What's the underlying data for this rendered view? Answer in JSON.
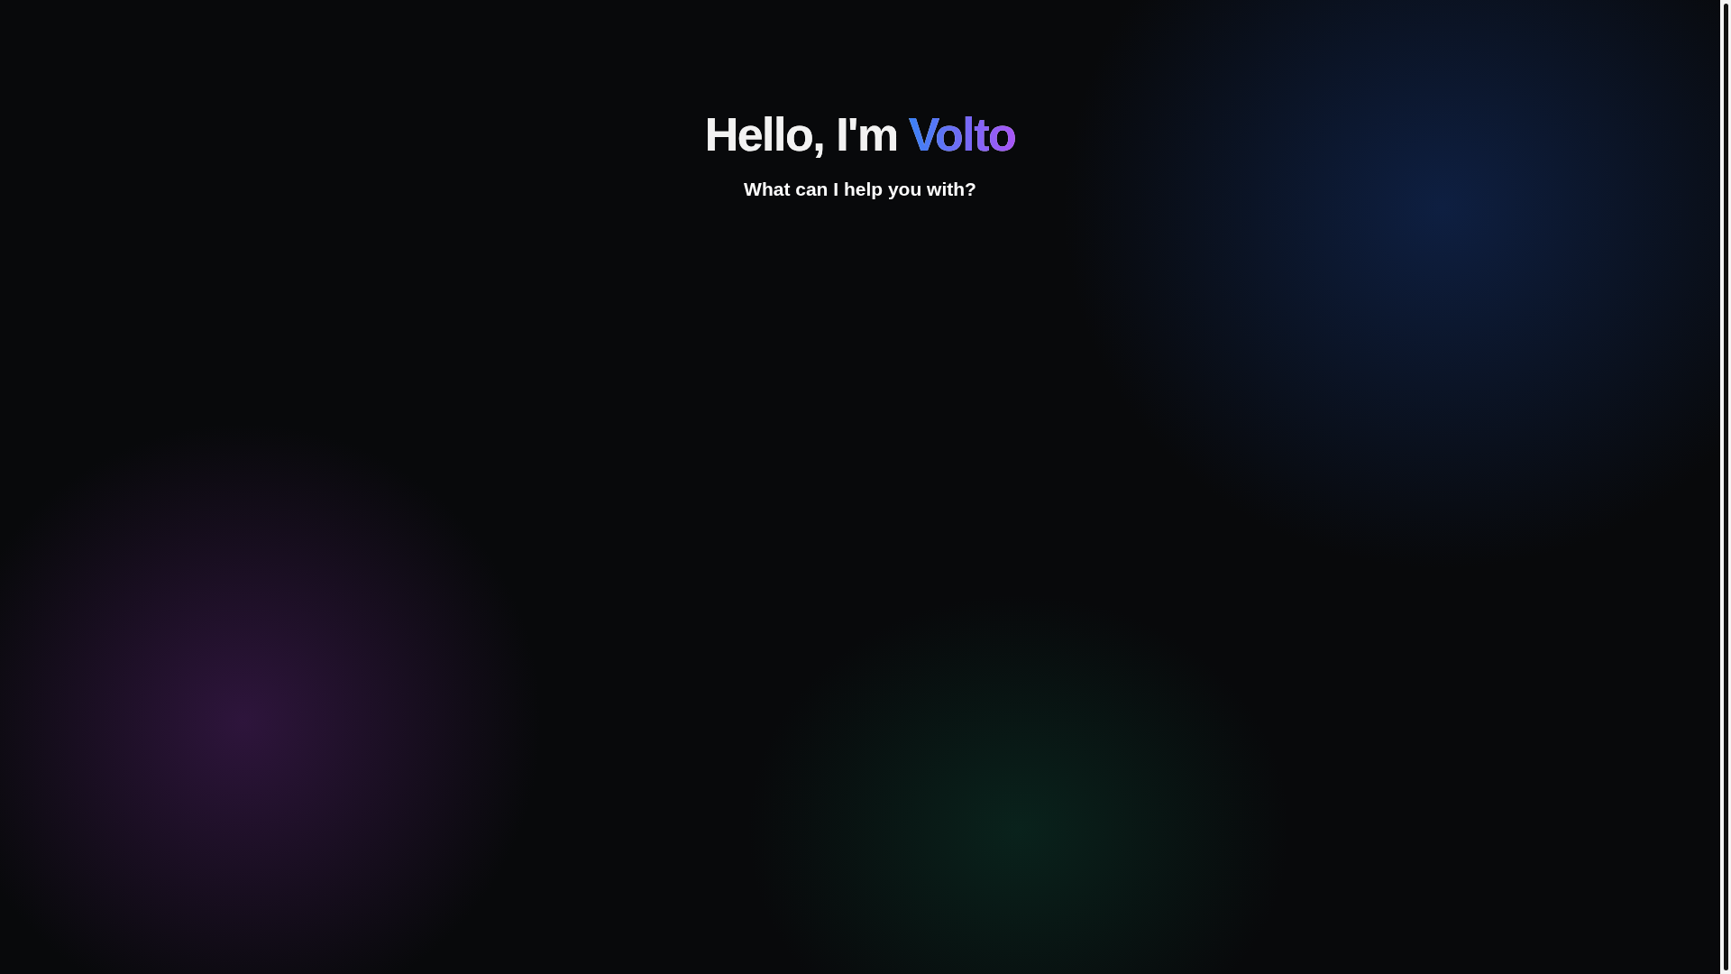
{
  "heading": {
    "text": "Hello, I'm",
    "highlight": "Volto"
  },
  "subtitle": "What can I help you with?"
}
